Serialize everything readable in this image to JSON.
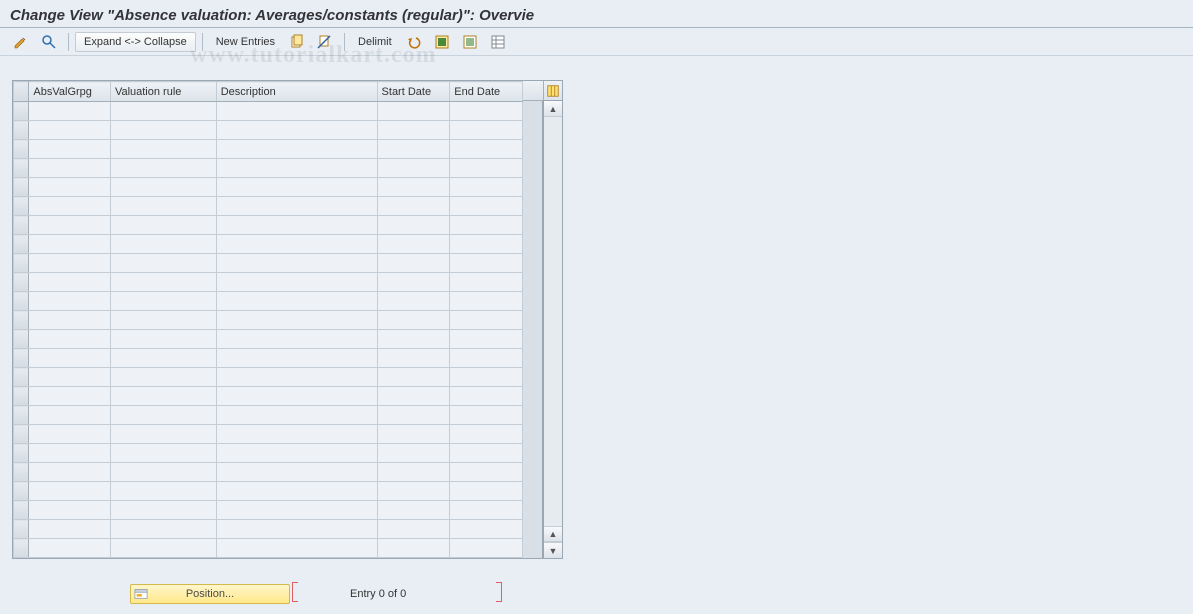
{
  "title": "Change View \"Absence valuation: Averages/constants (regular)\": Overvie",
  "watermark": "www.tutorialkart.com",
  "toolbar": {
    "expand_collapse": "Expand <-> Collapse",
    "new_entries": "New Entries",
    "delimit": "Delimit"
  },
  "table": {
    "columns": [
      "AbsValGrpg",
      "Valuation rule",
      "Description",
      "Start Date",
      "End Date"
    ],
    "row_count": 24,
    "rows": []
  },
  "footer": {
    "position_label": "Position...",
    "entry_text": "Entry 0 of 0"
  },
  "icons": {
    "pencil": "pencil-glasses-icon",
    "find": "find-icon",
    "copy": "copy-icon",
    "cut": "cut-icon",
    "undo": "undo-icon",
    "select_all": "select-all-icon",
    "deselect_all": "deselect-all-icon",
    "config": "config-icon",
    "column_config": "column-config-icon"
  }
}
